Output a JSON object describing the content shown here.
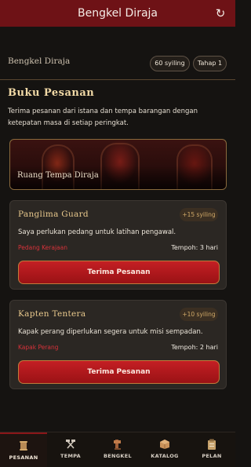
{
  "app": {
    "title": "Bengkel Diraja"
  },
  "header": {
    "title": "Bengkel Diraja",
    "coins": "60 syiling",
    "stage": "Tahap 1"
  },
  "section": {
    "title": "Buku Pesanan",
    "description": "Terima pesanan dari istana dan tempa barangan dengan ketepatan masa di setiap peringkat."
  },
  "banner": {
    "label": "Ruang Tempa Diraja"
  },
  "orders": [
    {
      "name": "Panglima Guard",
      "reward": "+15 syiling",
      "text": "Saya perlukan pedang untuk latihan pengawal.",
      "item": "Pedang Kerajaan",
      "deadline": "Tempoh: 3 hari",
      "button": "Terima Pesanan"
    },
    {
      "name": "Kapten Tentera",
      "reward": "+10 syiling",
      "text": "Kapak perang diperlukan segera untuk misi sempadan.",
      "item": "Kapak Perang",
      "deadline": "Tempoh: 2 hari",
      "button": "Terima Pesanan"
    }
  ],
  "nav": [
    {
      "label": "PESANAN",
      "icon": "scroll-icon",
      "active": true
    },
    {
      "label": "TEMPA",
      "icon": "crossed-hammers-icon",
      "active": false
    },
    {
      "label": "BENGKEL",
      "icon": "anvil-icon",
      "active": false
    },
    {
      "label": "KATALOG",
      "icon": "box-icon",
      "active": false
    },
    {
      "label": "PELAN",
      "icon": "clipboard-icon",
      "active": false
    }
  ],
  "colors": {
    "appbar": "#6e1216",
    "accent_gold": "#e9c98d",
    "button_red": "#c41f24",
    "item_red": "#d6323a"
  }
}
